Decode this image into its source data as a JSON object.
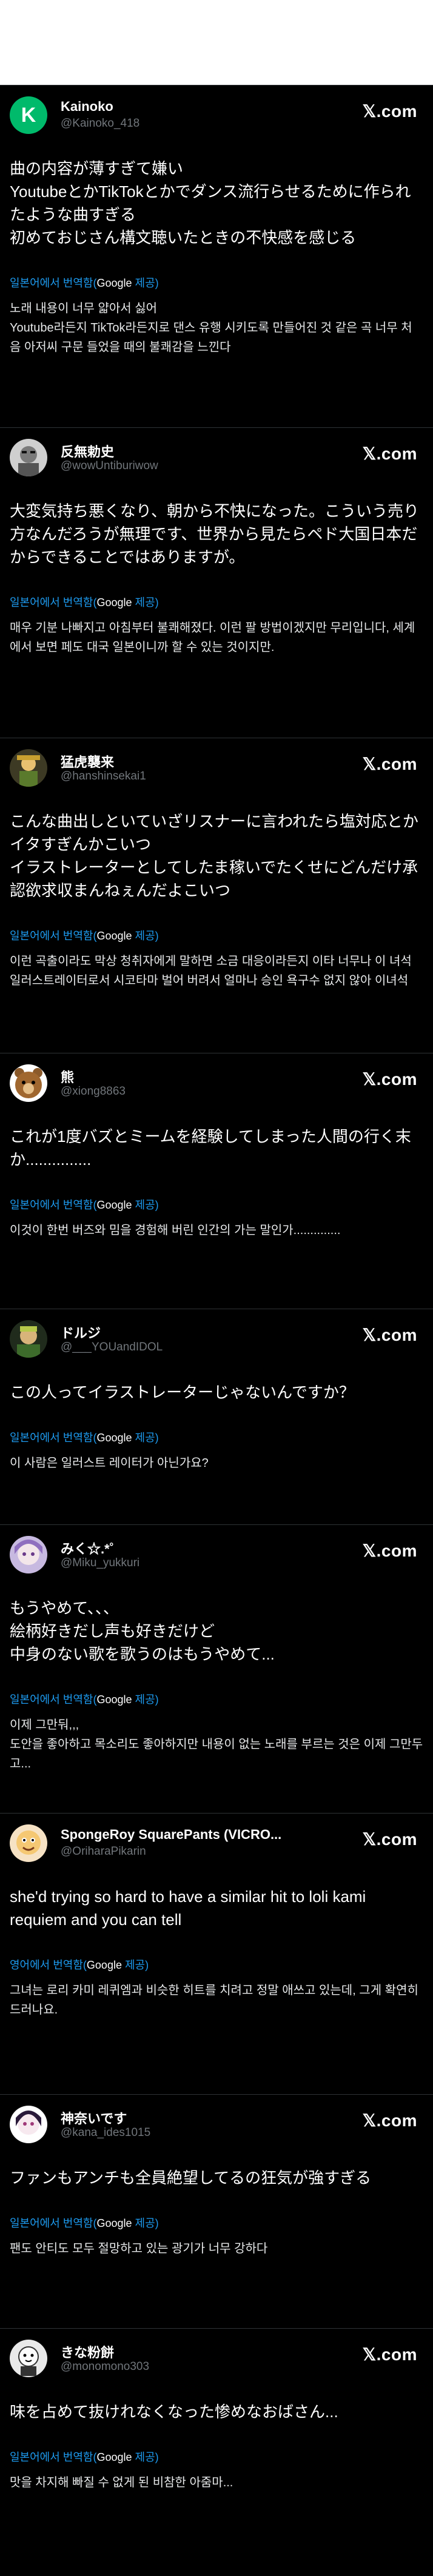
{
  "logo_text": "𝕏.com",
  "translate": {
    "ja_label": "일본어에서 번역함(",
    "en_label": "영어에서 번역함(",
    "google": "Google",
    "tail": " 제공)"
  },
  "tweets": [
    {
      "name": "Kainoko",
      "handle": "@Kainoko_418",
      "text": "曲の内容が薄すぎて嫌い\nYoutubeとかTikTokとかでダンス流行らせるために作られたような曲すぎる\n初めておじさん構文聴いたときの不快感を感じる",
      "translation": "노래 내용이 너무 얇아서 싫어\nYoutube라든지 TikTok라든지로 댄스 유행 시키도록 만들어진 것 같은 곡 너무 처음 아저씨 구문 들었을 때의 불쾌감을 느낀다"
    },
    {
      "name": "反無勅史",
      "handle": "@wowUntiburiwow",
      "text": "大変気持ち悪くなり、朝から不快になった。こういう売り方なんだろうが無理です、世界から見たらペド大国日本だからできることではありますが。",
      "translation": "매우 기분 나빠지고 아침부터 불쾌해졌다. 이런 팔 방법이겠지만 무리입니다, 세계에서 보면 페도 대국 일본이니까 할 수 있는 것이지만."
    },
    {
      "name": "猛虎襲来",
      "handle": "@hanshinsekai1",
      "text": "こんな曲出しといていざリスナーに言われたら塩対応とかイタすぎんかこいつ\nイラストレーターとしてしたま稼いでたくせにどんだけ承認欲求収まんねぇんだよこいつ",
      "translation": "이런 곡출이라도 막상 청취자에게 말하면 소금 대응이라든지 이타 너무나 이 녀석 일러스트레이터로서 시코타마 벌어 버려서 얼마나 승인 욕구수 없지 않아 이녀석"
    },
    {
      "name": "熊",
      "handle": "@xiong8863",
      "text": "これが1度バズとミームを経験してしまった人間の行く末か...............",
      "translation": "이것이 한번 버즈와 밈을 경험해 버린 인간의 가는 말인가.............."
    },
    {
      "name": "ドルジ",
      "handle": "@___YOUandIDOL",
      "text": "この人ってイラストレーターじゃないんですか？",
      "translation": "이 사람은 일러스트 레이터가 아닌가요?"
    },
    {
      "name": "みく☆.*˚",
      "handle": "@Miku_yukkuri",
      "text": "もうやめて、、、\n絵柄好きだし声も好きだけど\n中身のない歌を歌うのはもうやめて...",
      "translation": "이제 그만둬,,,\n도안을 좋아하고 목소리도 좋아하지만 내용이 없는 노래를 부르는 것은 이제 그만두고..."
    },
    {
      "name": "SpongeRoy SquarePants (VICRO...",
      "handle": "@OriharaPikarin",
      "text": "she'd trying so hard to have a similar hit to loli kami requiem and you can tell",
      "translation": "그녀는 로리 카미 레퀴엠과 비슷한 히트를 치려고 정말 애쓰고 있는데, 그게 확연히 드러나요."
    },
    {
      "name": "神奈いです",
      "handle": "@kana_ides1015",
      "text": "ファンもアンチも全員絶望してるの狂気が強すぎる",
      "translation": "팬도 안티도 모두 절망하고 있는 광기가 너무 강하다"
    },
    {
      "name": "きな粉餅",
      "handle": "@monomono303",
      "text": "味を占めて抜けれなくなった惨めなおばさん...",
      "translation": "맛을 차지해 빠질 수 없게 된 비참한 아줌마..."
    }
  ]
}
